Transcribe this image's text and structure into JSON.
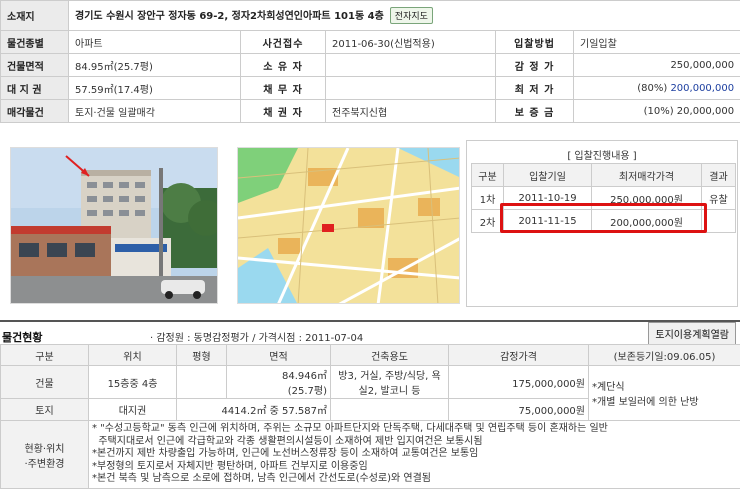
{
  "summary": {
    "addr_label": "소재지",
    "addr": "경기도 수원시 장안구 정자동 69-2, 정자2차희성연인아파트 101동 4층",
    "map_button": "전자지도",
    "rows": [
      {
        "l1": "물건종별",
        "v1": "아파트",
        "l2": "사건접수",
        "v2": "2011-06-30(신법적용)",
        "l3": "입찰방법",
        "v3": "기일입찰",
        "v3b": ""
      },
      {
        "l1": "건물면적",
        "v1": "84.95㎡(25.7평)",
        "l2": "소 유 자",
        "v2": "",
        "l3": "감 정 가",
        "v3": "250,000,000",
        "v3b": ""
      },
      {
        "l1": "대 지 권",
        "v1": "57.59㎡(17.4평)",
        "l2": "채 무 자",
        "v2": "",
        "l3": "최 저 가",
        "v3": "(80%)",
        "v3b": "200,000,000"
      },
      {
        "l1": "매각물건",
        "v1": "토지·건물 일괄매각",
        "l2": "채 권 자",
        "v2": "전주북지신협",
        "l3": "보 증 금",
        "v3": "(10%) 20,000,000",
        "v3b": ""
      }
    ]
  },
  "bid": {
    "title": "[ 입찰진행내용 ]",
    "headers": [
      "구분",
      "입찰기일",
      "최저매각가격",
      "결과"
    ],
    "rows": [
      {
        "round": "1차",
        "date": "2011-10-19",
        "price": "250,000,000원",
        "result": "유찰"
      },
      {
        "round": "2차",
        "date": "2011-11-15",
        "price": "200,000,000원",
        "result": ""
      }
    ]
  },
  "status": {
    "title": "물건현황",
    "sub": "· 감정원 : 동명감정평가 / 가격시점 : 2011-07-04",
    "plan_button": "토지이용계획열람",
    "headers": [
      "구분",
      "위치",
      "평형",
      "면적",
      "건축용도",
      "감정가격",
      "(보존등기일:09.06.05)"
    ],
    "building": {
      "label": "건물",
      "loc": "15층중 4층",
      "area1": "84.946㎡",
      "area2": "(25.7평)",
      "use1": "방3, 거실, 주방/식당, 욕",
      "use2": "실2, 발코니 등",
      "price": "175,000,000원"
    },
    "land": {
      "label": "토지",
      "loc": "대지권",
      "area": "4414.2㎡ 중 57.587㎡",
      "price": "75,000,000원"
    },
    "remark1": "*계단식",
    "remark2": "*개별 보일러에 의한 난방",
    "env_label1": "현황·위치",
    "env_label2": "·주변환경",
    "notes": [
      "* \"수성고등학교\" 동측 인근에 위치하며, 주위는 소규모 아파트단지와 단독주택, 다세대주택 및 연립주택 등이 혼재하는 일반",
      "  주택지대로서 인근에 각급학교와 각종 생활편의시설등이 소재하여 제반 입지여건은 보통시됨",
      "*본건까지 제반 차량출입 가능하며, 인근에 노선버스정류장 등이 소재하여 교통여건은 보통임",
      "*부정형의 토지로서 자체지반 평탄하며, 아파트 건부지로 이용중임",
      "*본건 북측 및 남측으로 소로에 접하며, 남측 인근에서 간선도로(수성로)와 연결됨"
    ]
  }
}
